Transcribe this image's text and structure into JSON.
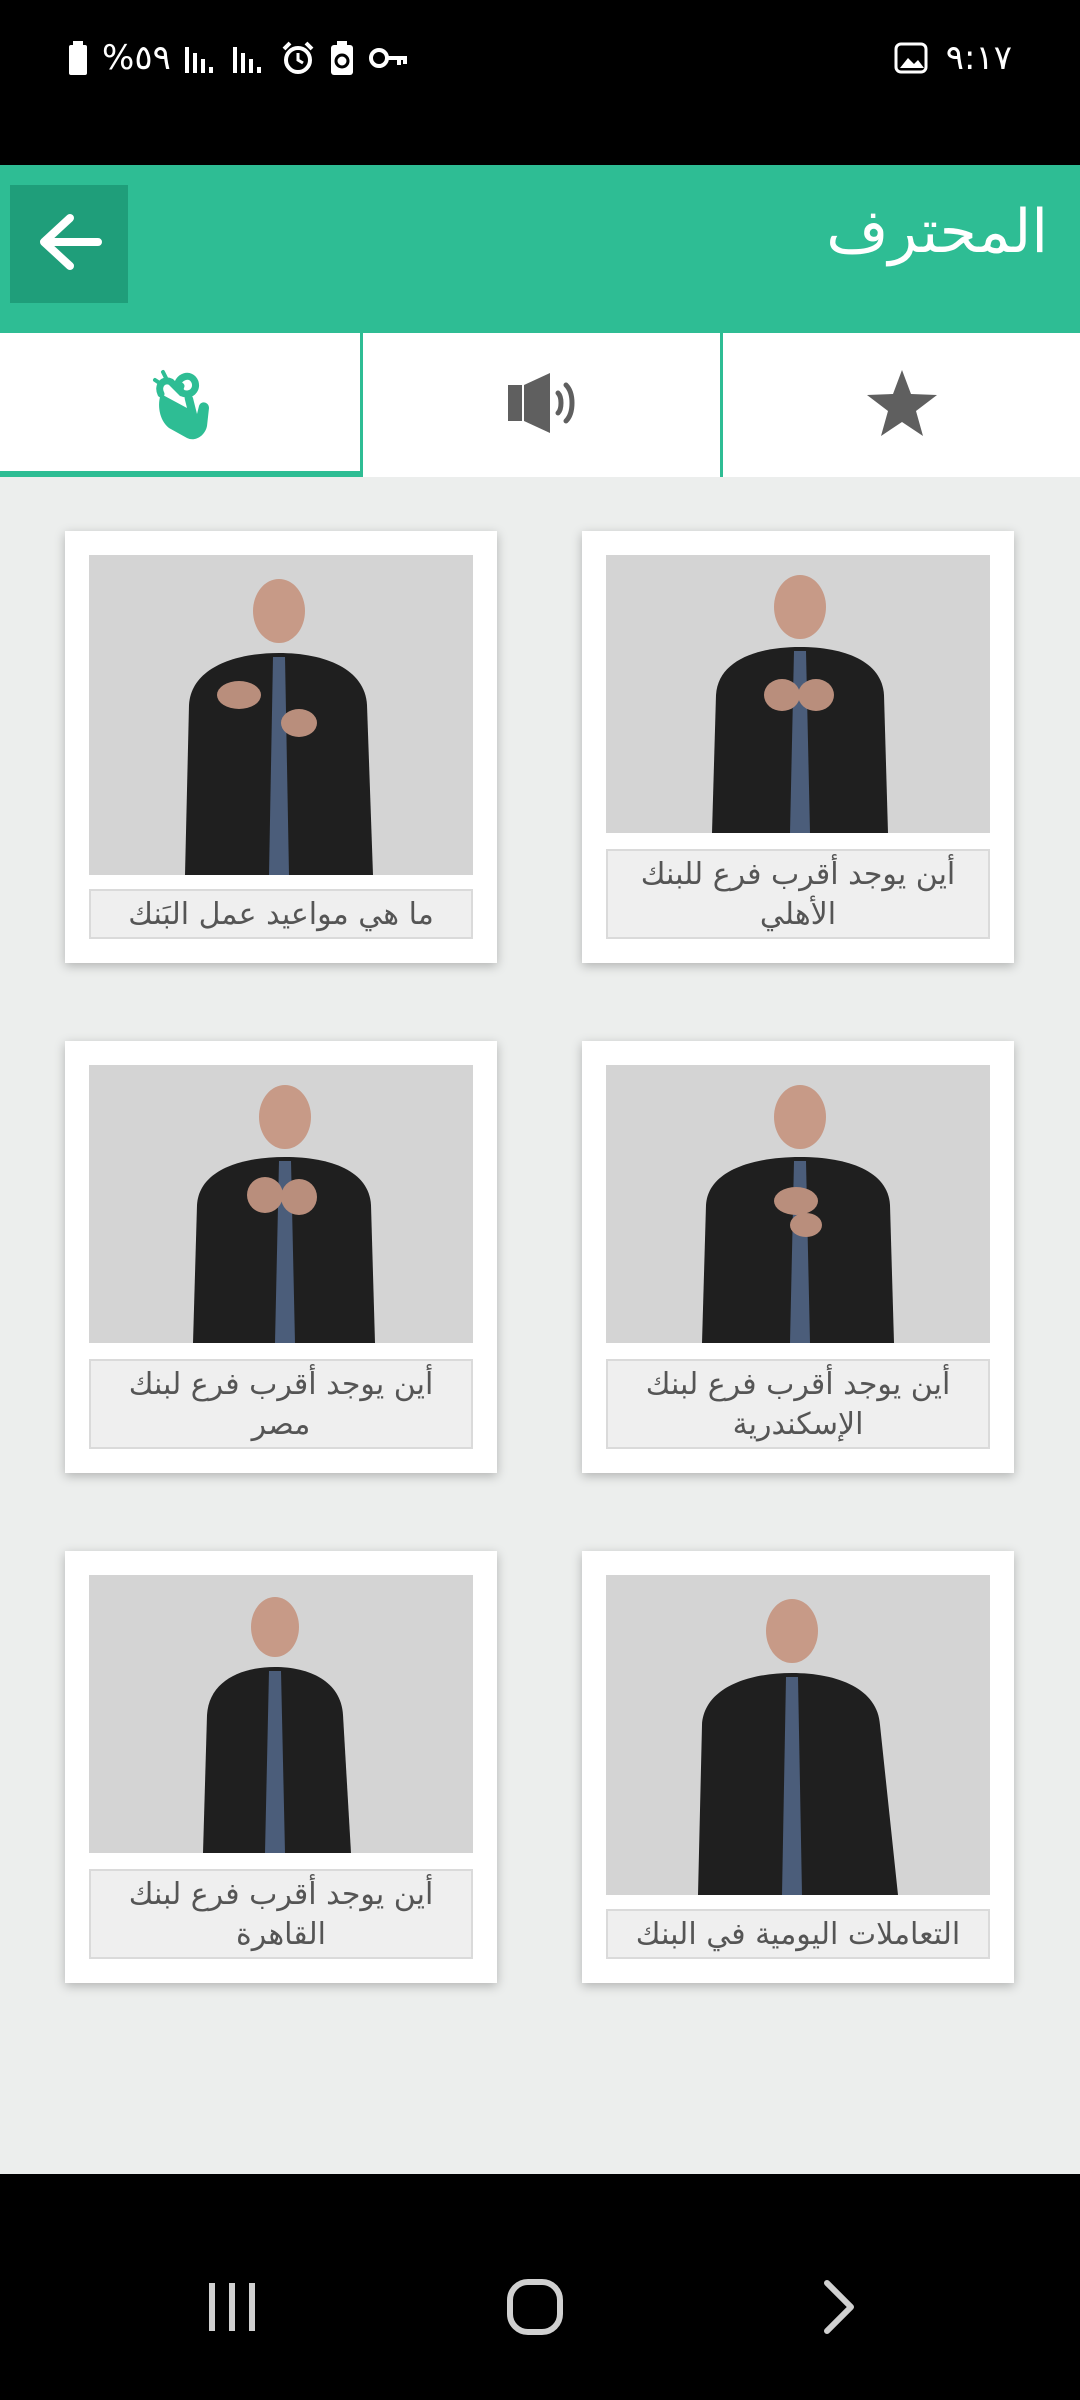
{
  "status_bar": {
    "battery_text": "%٥٩",
    "time": "٩:١٧"
  },
  "app_bar": {
    "title": "المحترف",
    "back_icon": "arrow-left-icon"
  },
  "tabs": [
    {
      "icon": "sign-language-hand-icon",
      "active": true
    },
    {
      "icon": "speaker-icon",
      "active": false
    },
    {
      "icon": "star-icon",
      "active": false
    }
  ],
  "cards": [
    {
      "caption": "أين يوجد أقرب فرع للبنك الأهلي"
    },
    {
      "caption": "ما هي مواعيد عمل البَنك"
    },
    {
      "caption": "أين يوجد أقرب فرع لبنك الإسكندرية"
    },
    {
      "caption": "أين يوجد أقرب فرع لبنك مصر"
    },
    {
      "caption": "التعاملات اليومية في البنك"
    },
    {
      "caption": "أين يوجد أقرب فرع لبنك القاهرة"
    }
  ],
  "colors": {
    "accent": "#2ebd94",
    "accent_dark": "#1f9e7a",
    "tab_icon_inactive": "#5f5f5f"
  }
}
